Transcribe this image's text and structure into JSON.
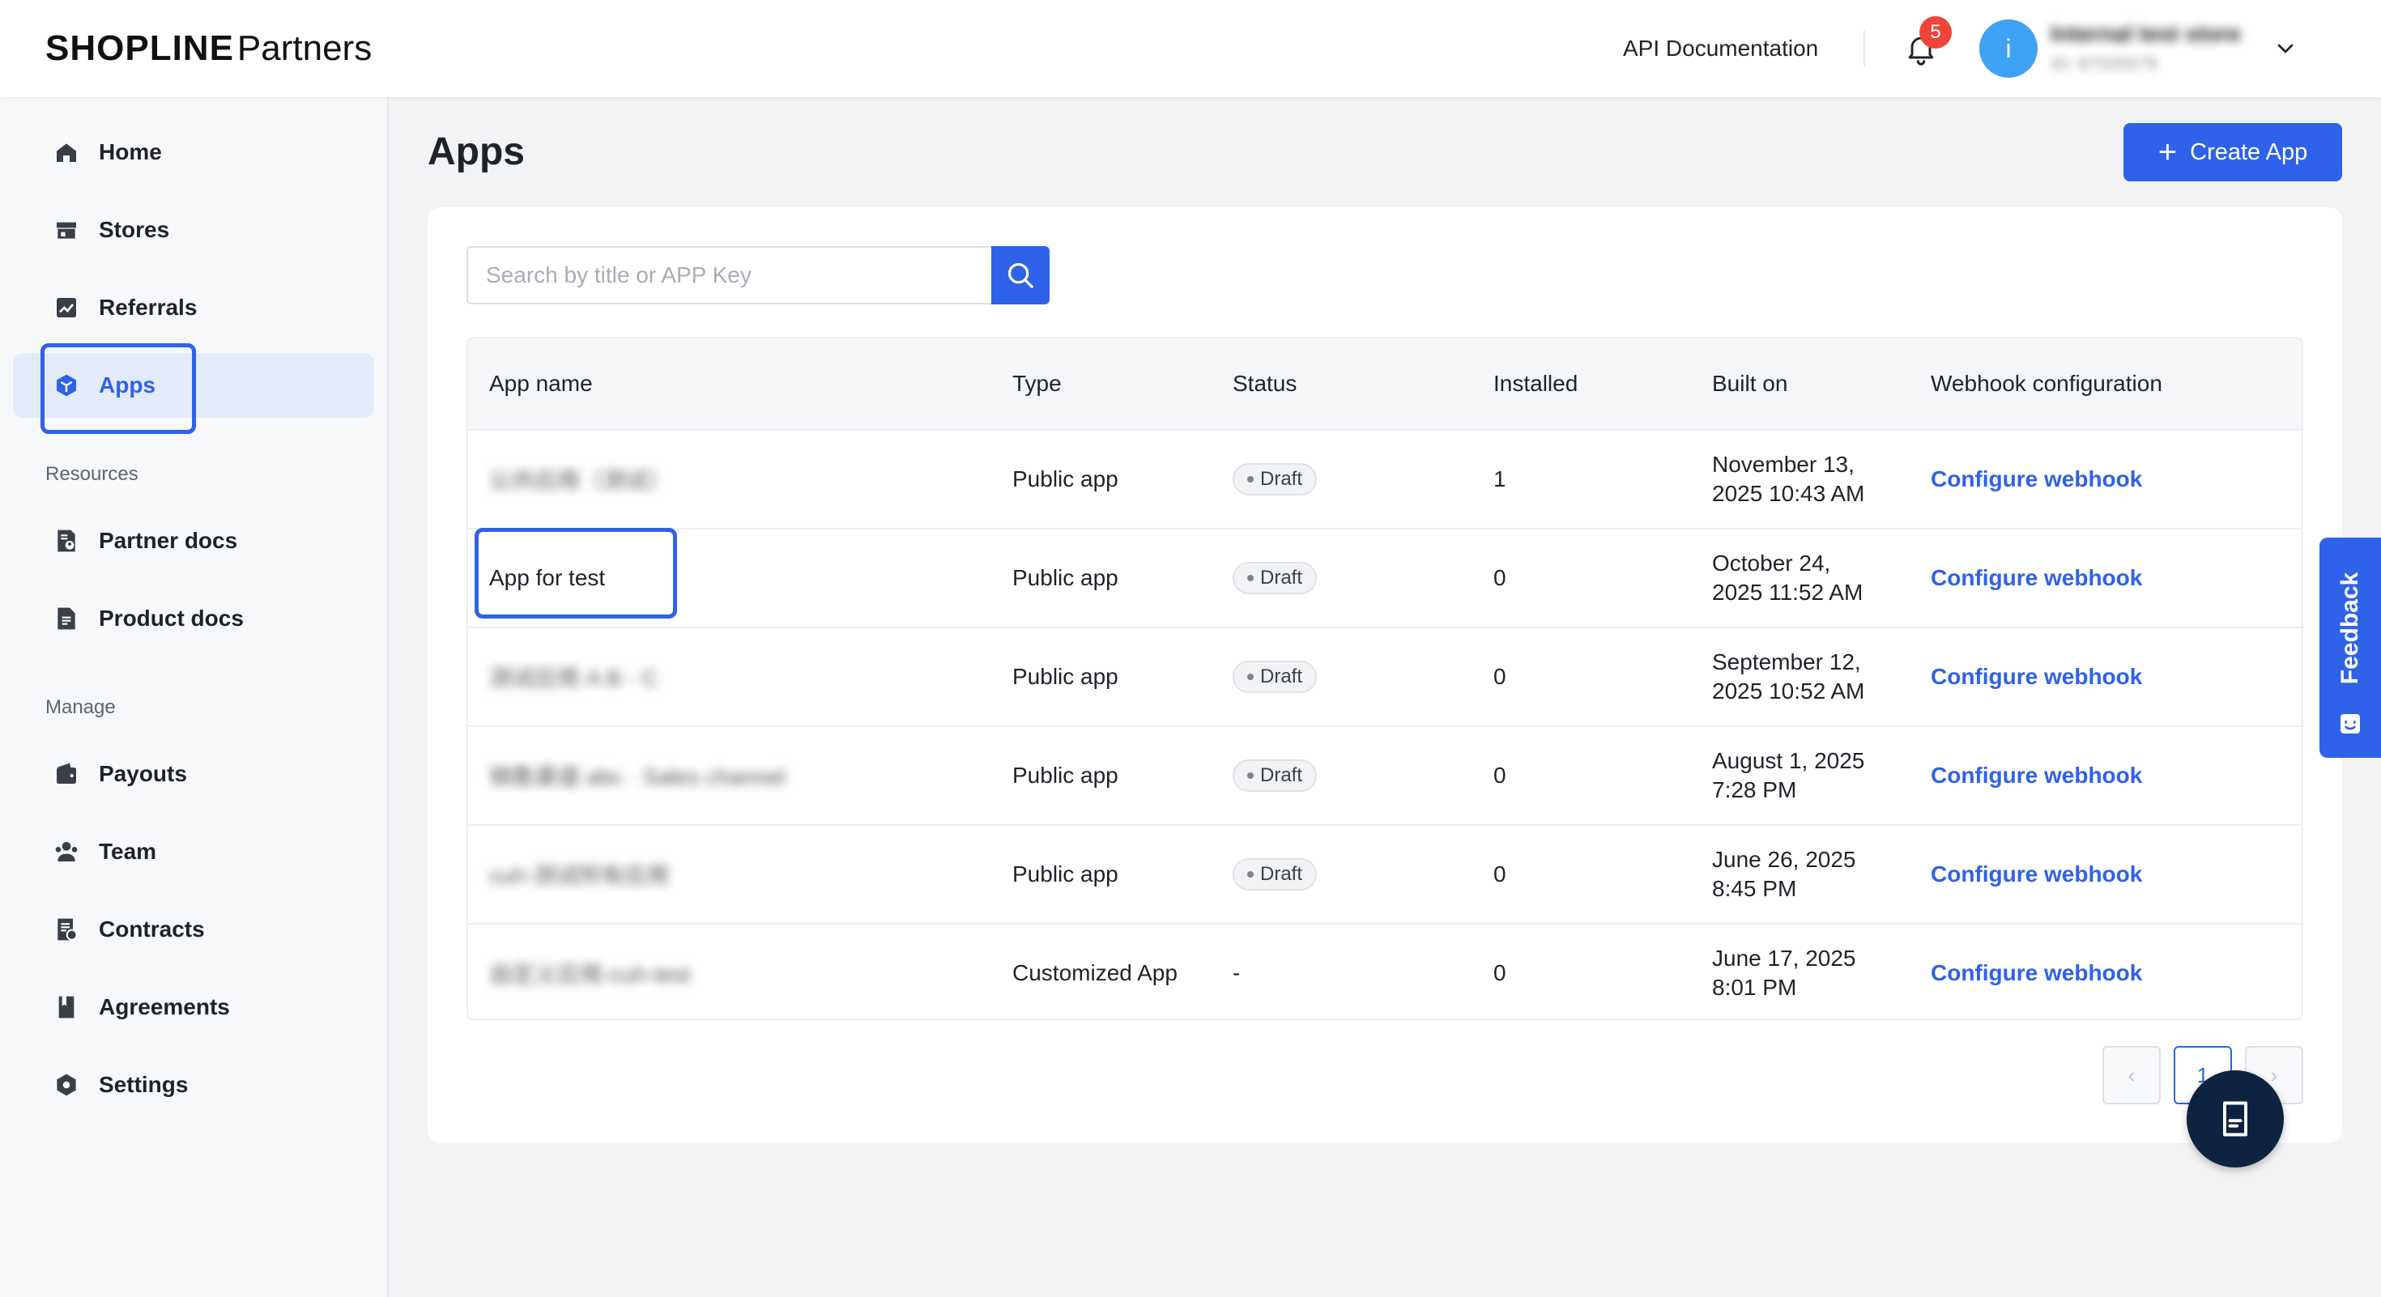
{
  "header": {
    "logo_brand": "SHOPLINE",
    "logo_suffix": "Partners",
    "api_doc": "API Documentation",
    "notification_count": "5",
    "avatar_initial": "i",
    "store_name": "Internal test store",
    "store_id": "ID: 87025578",
    "icons": {
      "bell": "bell-icon",
      "chevron": "chevron-down-icon"
    }
  },
  "sidebar": {
    "items": [
      {
        "label": "Home",
        "icon": "home-icon"
      },
      {
        "label": "Stores",
        "icon": "store-icon"
      },
      {
        "label": "Referrals",
        "icon": "chart-icon"
      },
      {
        "label": "Apps",
        "icon": "cube-icon",
        "active": true
      }
    ],
    "resources_title": "Resources",
    "resources": [
      {
        "label": "Partner docs",
        "icon": "doc-user-icon"
      },
      {
        "label": "Product docs",
        "icon": "doc-icon"
      }
    ],
    "manage_title": "Manage",
    "manage": [
      {
        "label": "Payouts",
        "icon": "wallet-icon"
      },
      {
        "label": "Team",
        "icon": "team-icon"
      },
      {
        "label": "Contracts",
        "icon": "contract-icon"
      },
      {
        "label": "Agreements",
        "icon": "agreement-icon"
      },
      {
        "label": "Settings",
        "icon": "gear-icon"
      }
    ]
  },
  "main": {
    "title": "Apps",
    "create_label": "Create App",
    "search_placeholder": "Search by title or APP Key",
    "columns": [
      "App name",
      "Type",
      "Status",
      "Installed",
      "Built on",
      "Webhook configuration"
    ],
    "rows": [
      {
        "name": "公共应用（测试）",
        "blurred": true,
        "type": "Public app",
        "status": "Draft",
        "installed": "1",
        "built_date": "November 13,",
        "built_time": "2025 10:43 AM",
        "webhook": "Configure webhook"
      },
      {
        "name": "App for test",
        "blurred": false,
        "type": "Public app",
        "status": "Draft",
        "installed": "0",
        "built_date": "October 24,",
        "built_time": "2025 11:52 AM",
        "webhook": "Configure webhook"
      },
      {
        "name": "测试应用 A B - C",
        "blurred": true,
        "type": "Public app",
        "status": "Draft",
        "installed": "0",
        "built_date": "September 12,",
        "built_time": "2025 10:52 AM",
        "webhook": "Configure webhook"
      },
      {
        "name": "销售渠道 abc · Sales channel",
        "blurred": true,
        "type": "Public app",
        "status": "Draft",
        "installed": "0",
        "built_date": "August 1, 2025",
        "built_time": "7:28 PM",
        "webhook": "Configure webhook"
      },
      {
        "name": "cuh-测试所有应用",
        "blurred": true,
        "type": "Public app",
        "status": "Draft",
        "installed": "0",
        "built_date": "June 26, 2025",
        "built_time": "8:45 PM",
        "webhook": "Configure webhook"
      },
      {
        "name": "自定义应用-cuh-test",
        "blurred": true,
        "type": "Customized App",
        "status": "-",
        "installed": "0",
        "built_date": "June 17, 2025",
        "built_time": "8:01 PM",
        "webhook": "Configure webhook"
      }
    ],
    "pagination": {
      "prev": "‹",
      "current": "1",
      "next": "›"
    }
  },
  "feedback_label": "Feedback",
  "colors": {
    "accent": "#2e62e8",
    "fab": "#0e2340",
    "badge": "#f04438",
    "avatar": "#3ea2f5"
  }
}
